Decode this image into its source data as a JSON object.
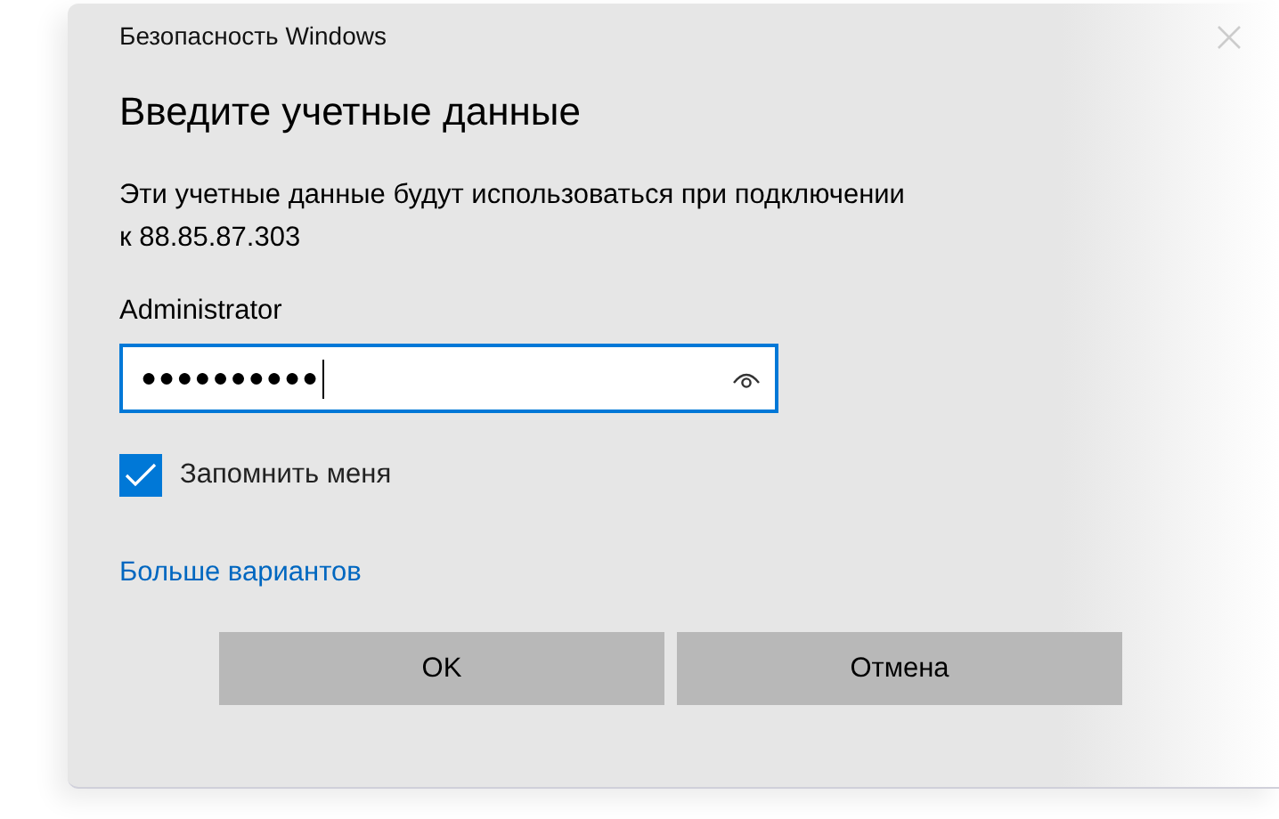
{
  "window": {
    "title": "Безопасность Windows"
  },
  "heading": "Введите учетные данные",
  "message": {
    "line_1": "Эти учетные данные будут использоваться при подключении",
    "line_2": "к 88.85.87.303"
  },
  "username": "Administrator",
  "password": {
    "value": "●●●●●●●●●●",
    "focused": true
  },
  "remember": {
    "label": "Запомнить меня",
    "checked": true
  },
  "more_link": "Больше вариантов",
  "buttons": [
    {
      "label": "OK"
    },
    {
      "label": "Отмена"
    }
  ]
}
